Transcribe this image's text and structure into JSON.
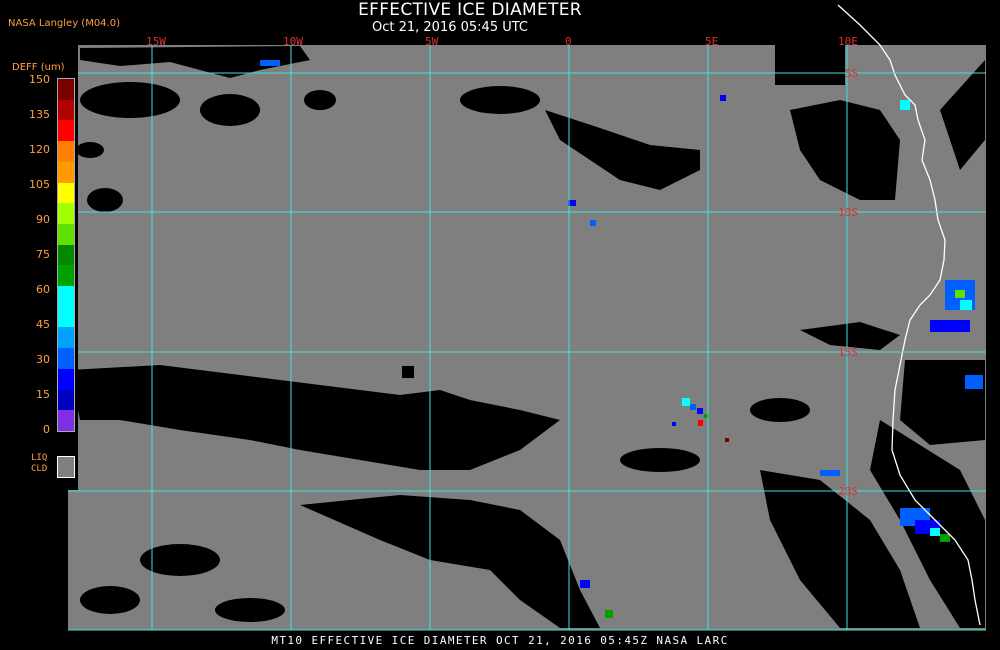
{
  "header": {
    "title": "EFFECTIVE ICE DIAMETER",
    "subtitle": "Oct 21, 2016 05:45 UTC",
    "credit": "NASA Langley (M04.0)"
  },
  "map": {
    "longitude_labels": [
      "15W",
      "10W",
      "5W",
      "0",
      "5E",
      "10E"
    ],
    "latitude_labels": [
      "5S",
      "10S",
      "15S",
      "20S"
    ],
    "colors": {
      "background": "#000000",
      "liquid_cloud": "#7f7f7f",
      "gridlines": "#40e0e0",
      "coastline": "#ffffff",
      "grid_labels": "#e03030"
    }
  },
  "colorbar": {
    "units": "DEFF (um)",
    "ticks": [
      "150",
      "135",
      "120",
      "105",
      "90",
      "75",
      "60",
      "45",
      "30",
      "15",
      "0"
    ],
    "colors": [
      "#7a0000",
      "#b00000",
      "#ff0000",
      "#ff7f00",
      "#ff9a00",
      "#ffff00",
      "#a0ff00",
      "#60e000",
      "#008800",
      "#00a000",
      "#00ffff",
      "#00ffff",
      "#00a0ff",
      "#0060ff",
      "#0000ff",
      "#0000c0",
      "#8030e0"
    ],
    "liquid_cloud_label_line1": "LIQ",
    "liquid_cloud_label_line2": "CLD"
  },
  "footer": {
    "text": "MT10  EFFECTIVE ICE DIAMETER  OCT 21, 2016 05:45Z  NASA LARC"
  }
}
